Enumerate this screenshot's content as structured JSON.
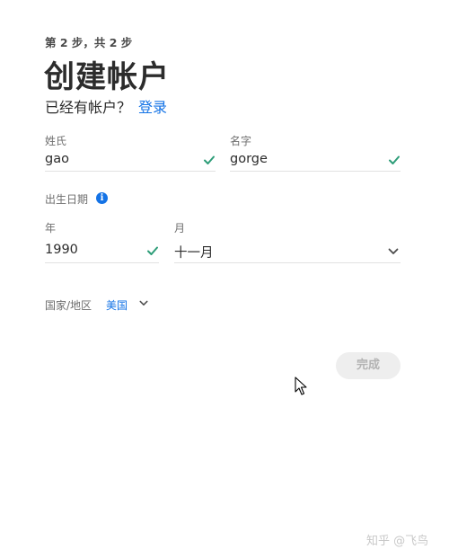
{
  "header": {
    "step_text": "第 2 步，共 2 步",
    "title": "创建帐户",
    "have_account_text": "已经有帐户？",
    "signin_link": "登录"
  },
  "form": {
    "last_name": {
      "label": "姓氏",
      "value": "gao",
      "valid": true
    },
    "first_name": {
      "label": "名字",
      "value": "gorge",
      "valid": true
    },
    "dob": {
      "label": "出生日期",
      "info_icon": "info-icon",
      "year": {
        "label": "年",
        "value": "1990",
        "valid": true
      },
      "month": {
        "label": "月",
        "selected": "十一月"
      }
    },
    "country": {
      "label": "国家/地区",
      "selected": "美国"
    }
  },
  "actions": {
    "done_label": "完成"
  },
  "watermark": {
    "text": "知乎 @飞鸟"
  },
  "colors": {
    "accent": "#1473e6",
    "valid": "#2d9d78",
    "text": "#2c2c2c",
    "muted": "#6e6e6e",
    "disabled_button_bg": "#eeeeee",
    "disabled_button_text": "#b3b3b3"
  }
}
